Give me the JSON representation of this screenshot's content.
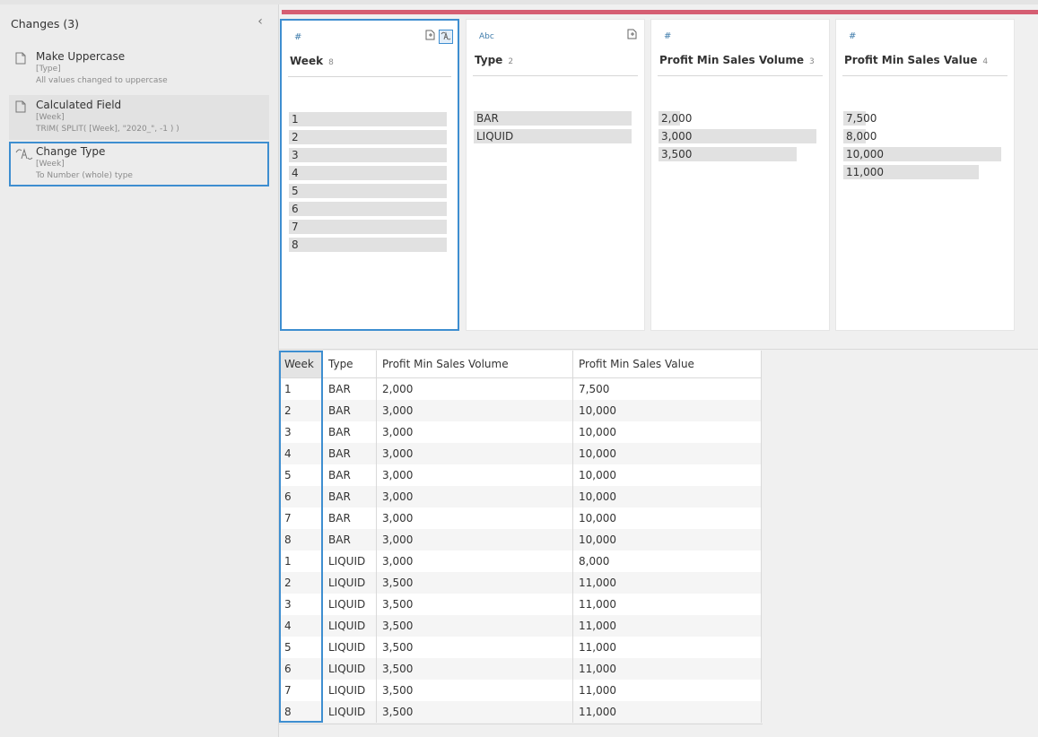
{
  "changes": {
    "title": "Changes (3)",
    "collapse_glyph": "‹",
    "items": [
      {
        "name": "Make Uppercase",
        "field": "[Type]",
        "desc": "All values changed to uppercase",
        "icon": "script-icon"
      },
      {
        "name": "Calculated Field",
        "field": "[Week]",
        "desc": "TRIM( SPLIT( [Week], \"2020_\", -1 ) )",
        "icon": "script-icon"
      },
      {
        "name": "Change Type",
        "field": "[Week]",
        "desc": "To Number (whole) type",
        "icon": "change-type-icon"
      }
    ]
  },
  "profile": {
    "cards": [
      {
        "type_label": "#",
        "header": "Week",
        "count": "8",
        "values": [
          "1",
          "2",
          "3",
          "4",
          "5",
          "6",
          "7",
          "8"
        ],
        "fill": [
          1,
          1,
          1,
          1,
          1,
          1,
          1,
          1
        ]
      },
      {
        "type_label": "Abc",
        "header": "Type",
        "count": "2",
        "values": [
          "BAR",
          "LIQUID"
        ],
        "fill": [
          1,
          1
        ]
      },
      {
        "type_label": "#",
        "header": "Profit Min Sales Volume",
        "count": "3",
        "values": [
          "2,000",
          "3,000",
          "3,500"
        ],
        "fill": [
          0.125,
          1,
          0.875
        ]
      },
      {
        "type_label": "#",
        "header": "Profit Min Sales Value",
        "count": "4",
        "values": [
          "7,500",
          "8,000",
          "10,000",
          "11,000"
        ],
        "fill": [
          0.14,
          0.14,
          1,
          0.86
        ]
      }
    ],
    "change_type_glyph": "Ɐ",
    "script_glyph": "▯"
  },
  "grid": {
    "columns": [
      "Week",
      "Type",
      "Profit Min Sales Volume",
      "Profit Min Sales Value"
    ],
    "rows": [
      [
        "1",
        "BAR",
        "2,000",
        "7,500"
      ],
      [
        "2",
        "BAR",
        "3,000",
        "10,000"
      ],
      [
        "3",
        "BAR",
        "3,000",
        "10,000"
      ],
      [
        "4",
        "BAR",
        "3,000",
        "10,000"
      ],
      [
        "5",
        "BAR",
        "3,000",
        "10,000"
      ],
      [
        "6",
        "BAR",
        "3,000",
        "10,000"
      ],
      [
        "7",
        "BAR",
        "3,000",
        "10,000"
      ],
      [
        "8",
        "BAR",
        "3,000",
        "10,000"
      ],
      [
        "1",
        "LIQUID",
        "3,000",
        "8,000"
      ],
      [
        "2",
        "LIQUID",
        "3,500",
        "11,000"
      ],
      [
        "3",
        "LIQUID",
        "3,500",
        "11,000"
      ],
      [
        "4",
        "LIQUID",
        "3,500",
        "11,000"
      ],
      [
        "5",
        "LIQUID",
        "3,500",
        "11,000"
      ],
      [
        "6",
        "LIQUID",
        "3,500",
        "11,000"
      ],
      [
        "7",
        "LIQUID",
        "3,500",
        "11,000"
      ],
      [
        "8",
        "LIQUID",
        "3,500",
        "11,000"
      ]
    ]
  },
  "colors": {
    "accent": "#3e8ed0",
    "progress": "#d55e72",
    "type_icon": "#3f7cab"
  }
}
